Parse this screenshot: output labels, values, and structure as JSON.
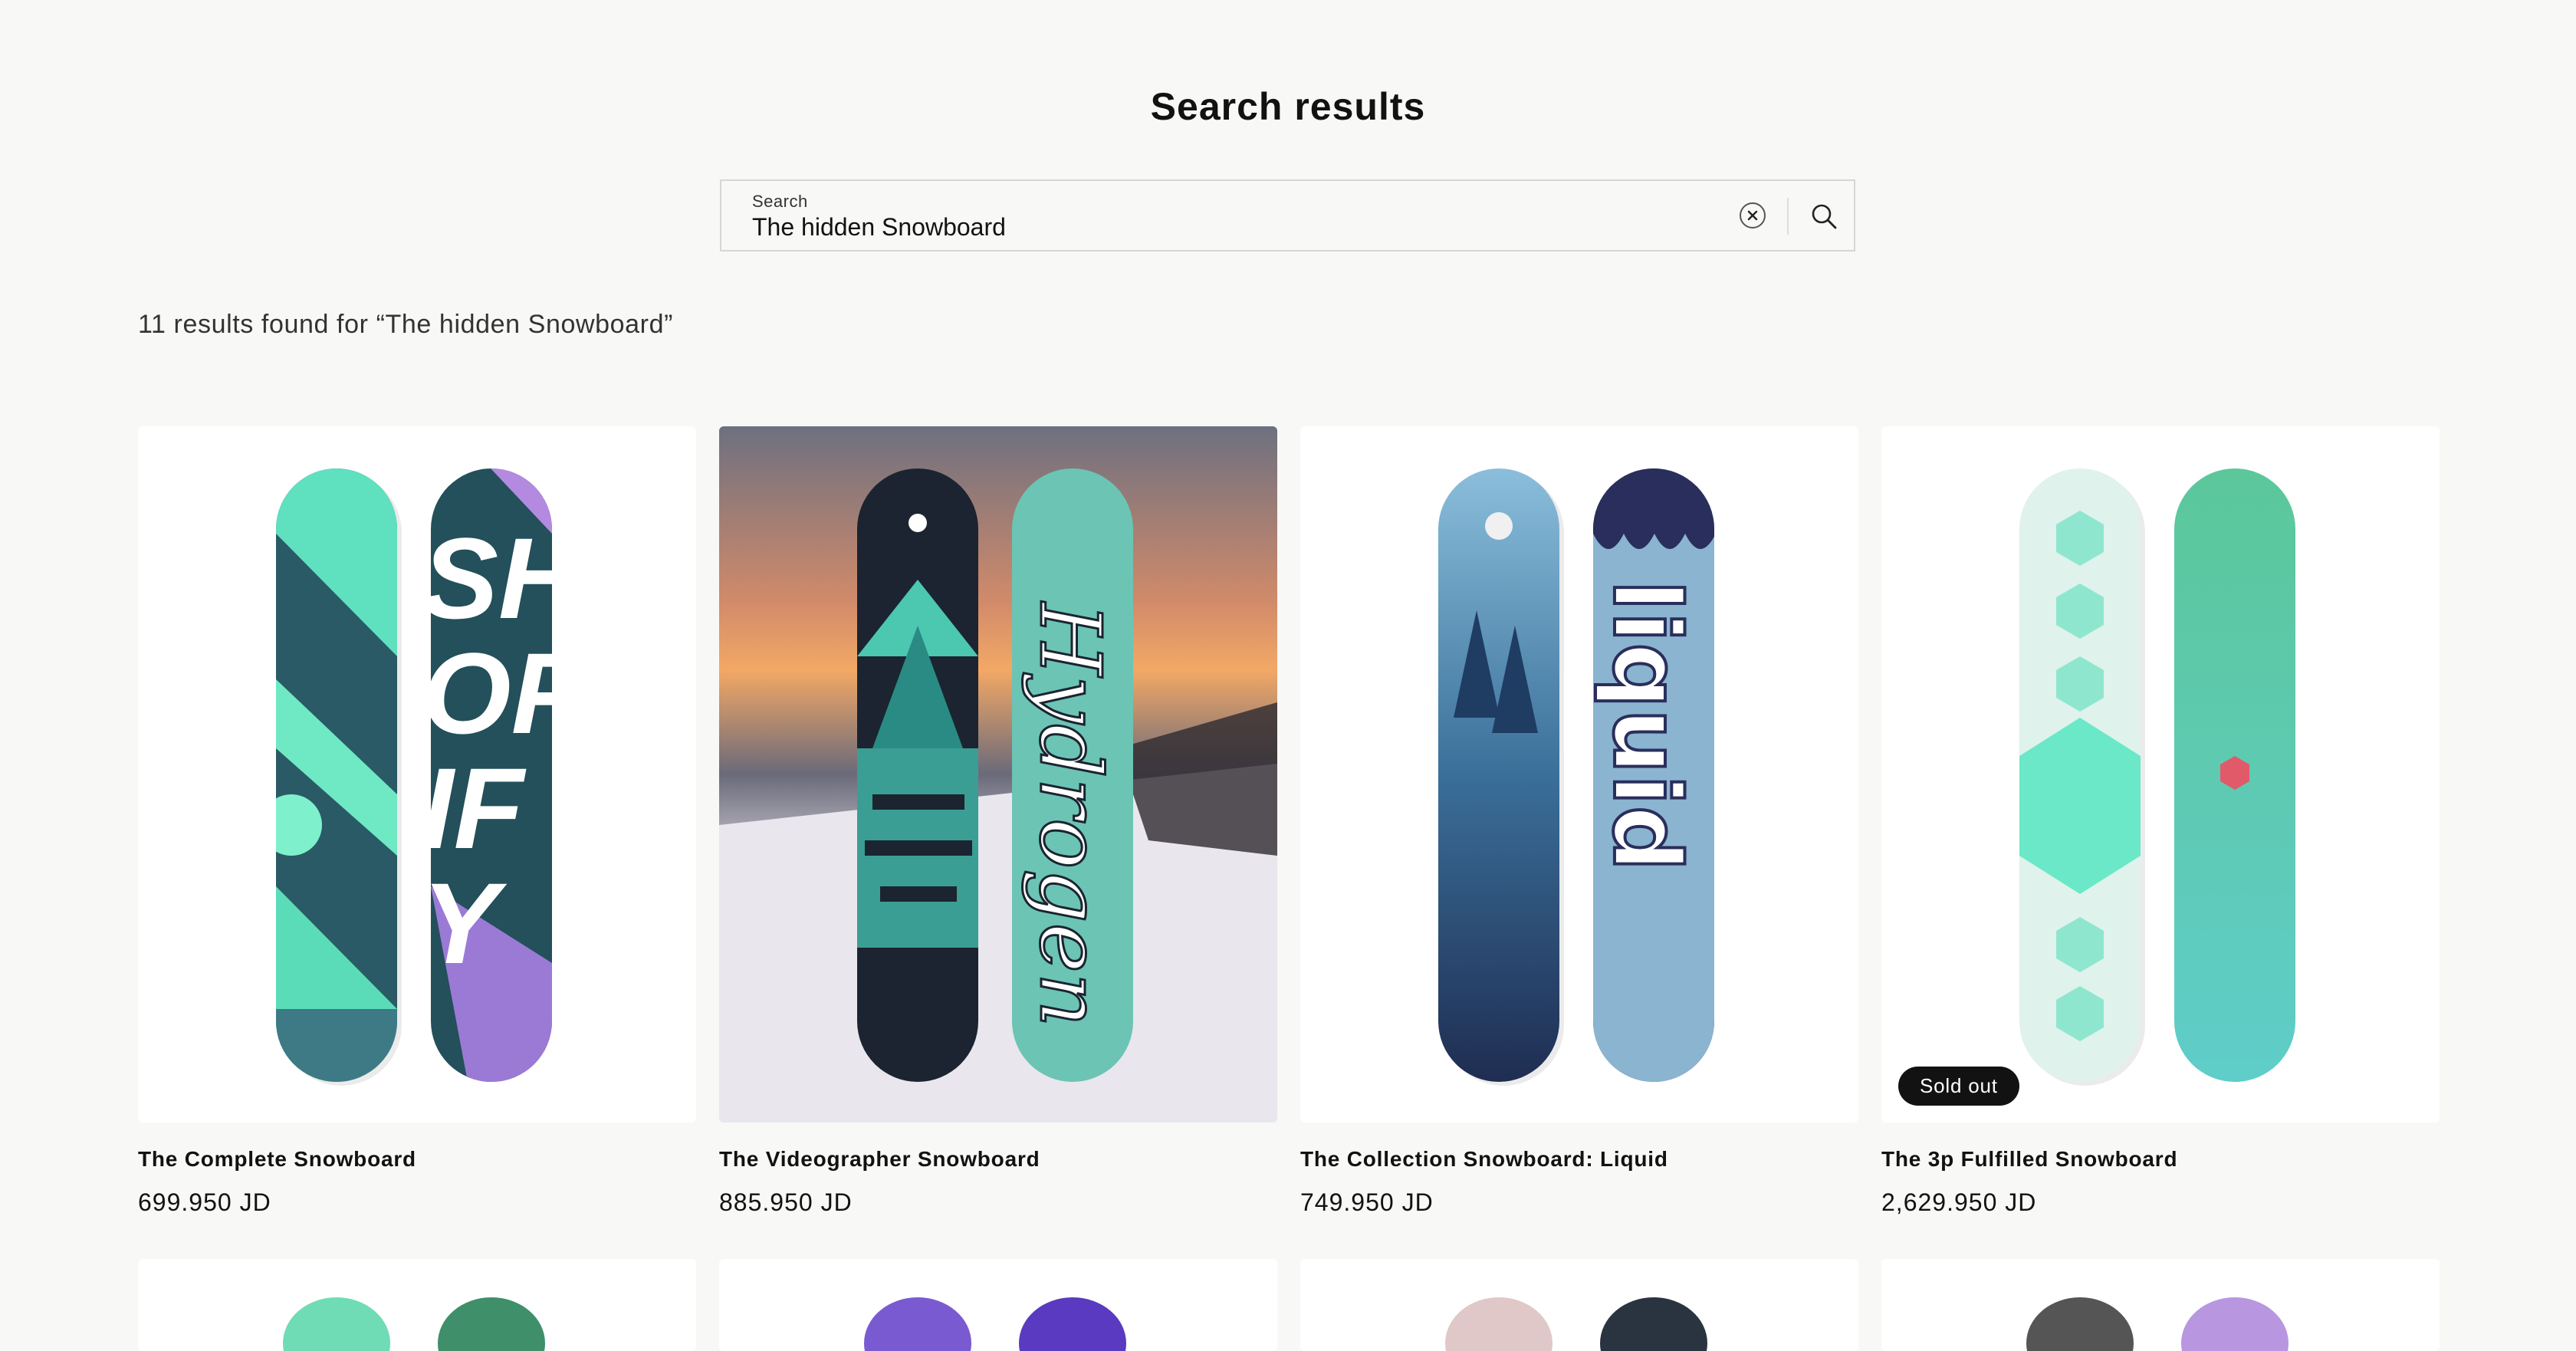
{
  "page": {
    "title": "Search results"
  },
  "search": {
    "label": "Search",
    "value": "The hidden Snowboard"
  },
  "results": {
    "summary": "11 results found for “The hidden Snowboard”"
  },
  "products": [
    {
      "title": "The Complete Snowboard",
      "price": "699.950 JD",
      "badge": ""
    },
    {
      "title": "The Videographer Snowboard",
      "price": "885.950 JD",
      "badge": ""
    },
    {
      "title": "The Collection Snowboard: Liquid",
      "price": "749.950 JD",
      "badge": ""
    },
    {
      "title": "The 3p Fulfilled Snowboard",
      "price": "2,629.950 JD",
      "badge": "Sold out"
    }
  ],
  "colors": {
    "background": "#f8f8f6",
    "card": "#ffffff",
    "badge": "#121212",
    "text": "#121212"
  },
  "icons": {
    "clear": "close-circle-icon",
    "search": "search-icon"
  }
}
